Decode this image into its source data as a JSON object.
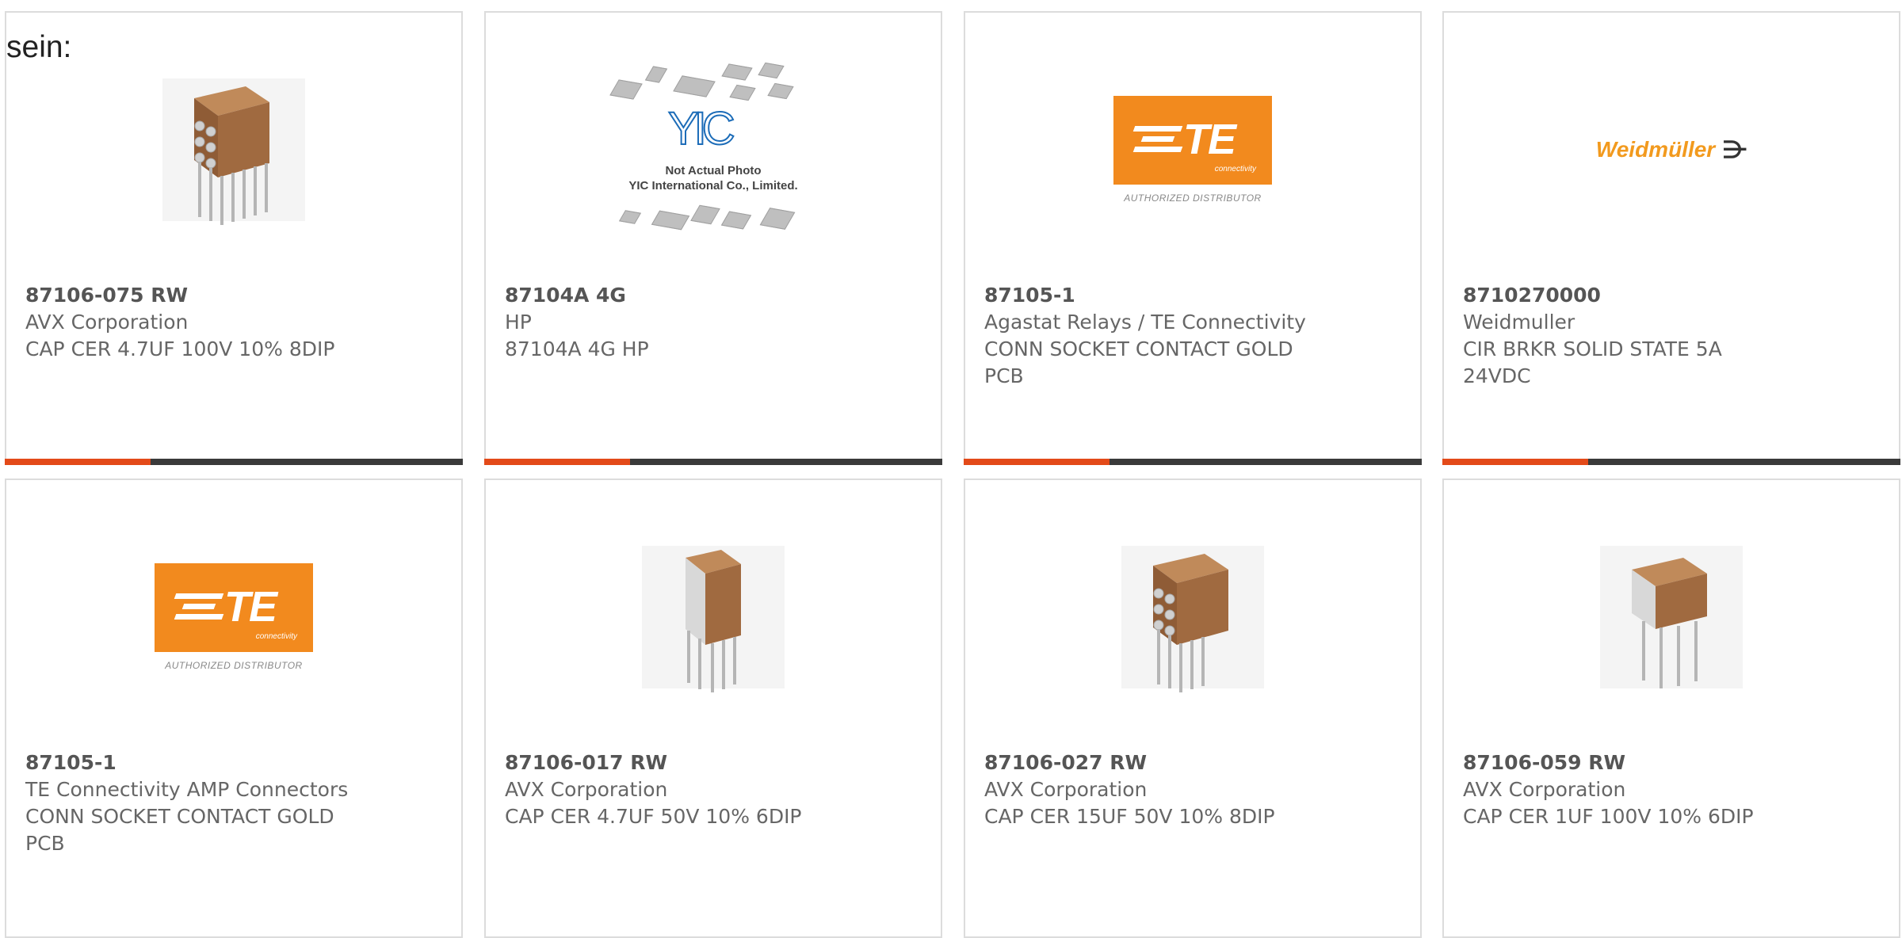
{
  "intro_text": "sein:",
  "products": [
    {
      "part_number": "87106-075 RW",
      "manufacturer": "AVX Corporation",
      "description": "CAP CER 4.7UF 100V 10% 8DIP",
      "image_type": "capacitor-8dip-photo"
    },
    {
      "part_number": "87104A 4G",
      "manufacturer": "HP",
      "description": "87104A 4G HP",
      "image_type": "not-actual-photo-placeholder",
      "image_caption_line1": "Not Actual Photo",
      "image_caption_line2": "YIC International Co., Limited.",
      "image_logo_text": "YIC"
    },
    {
      "part_number": "87105-1",
      "manufacturer": "Agastat Relays / TE Connectivity",
      "description": "CONN SOCKET CONTACT GOLD PCB",
      "image_type": "te-logo",
      "logo_text": "TE",
      "logo_sub": "connectivity",
      "logo_caption": "AUTHORIZED DISTRIBUTOR"
    },
    {
      "part_number": "8710270000",
      "manufacturer": "Weidmuller",
      "description": "CIR BRKR SOLID STATE 5A 24VDC",
      "image_type": "weidmuller-logo",
      "logo_text": "Weidmüller"
    },
    {
      "part_number": "87105-1",
      "manufacturer": "TE Connectivity AMP Connectors",
      "description": "CONN SOCKET CONTACT GOLD PCB",
      "image_type": "te-logo",
      "logo_text": "TE",
      "logo_sub": "connectivity",
      "logo_caption": "AUTHORIZED DISTRIBUTOR"
    },
    {
      "part_number": "87106-017 RW",
      "manufacturer": "AVX Corporation",
      "description": "CAP CER 4.7UF 50V 10% 6DIP",
      "image_type": "capacitor-6dip-photo"
    },
    {
      "part_number": "87106-027 RW",
      "manufacturer": "AVX Corporation",
      "description": "CAP CER 15UF 50V 10% 8DIP",
      "image_type": "capacitor-8dip-photo"
    },
    {
      "part_number": "87106-059 RW",
      "manufacturer": "AVX Corporation",
      "description": "CAP CER 1UF 100V 10% 6DIP",
      "image_type": "capacitor-6dip-photo"
    }
  ],
  "colors": {
    "accent_bar": "#e34a19",
    "dark_bar": "#3a3a3a",
    "te_orange": "#f28a1e",
    "weidmuller_orange": "#f29a1e",
    "yic_blue": "#1c6cb8"
  }
}
